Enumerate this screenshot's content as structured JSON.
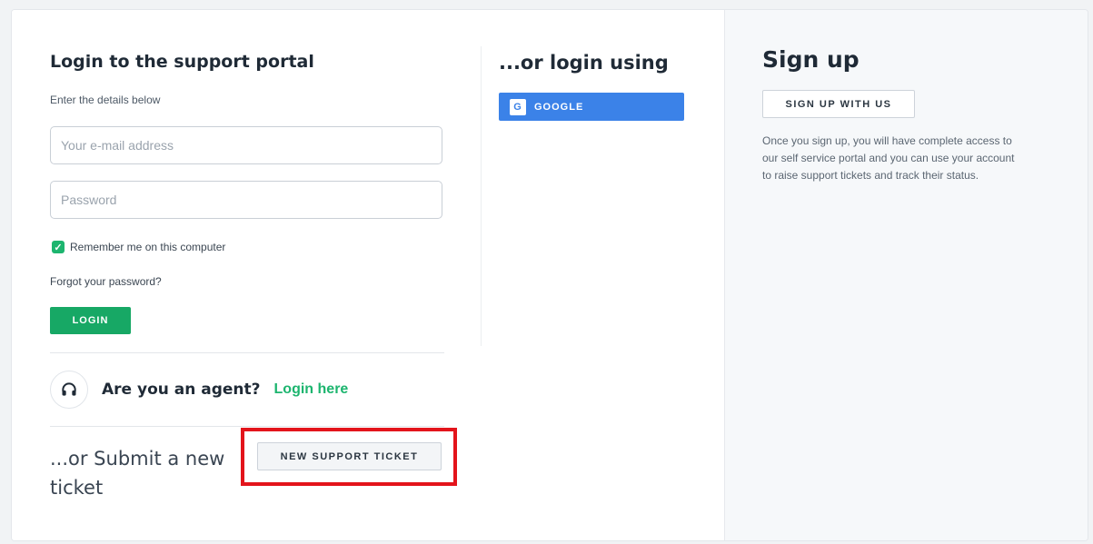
{
  "login": {
    "title": "Login to the support portal",
    "hint": "Enter the details below",
    "email_placeholder": "Your e-mail address",
    "password_placeholder": "Password",
    "remember_label": "Remember me on this computer",
    "remember_checked": true,
    "forgot_label": "Forgot your password?",
    "login_button": "LOGIN"
  },
  "social": {
    "title": "...or login using",
    "google_button": "GOOGLE",
    "google_icon": "G"
  },
  "agent": {
    "question": "Are you an agent?",
    "link": "Login here"
  },
  "ticket": {
    "text": "...or Submit a new ticket",
    "button": "NEW SUPPORT TICKET"
  },
  "signup": {
    "title": "Sign up",
    "button": "SIGN UP WITH US",
    "description": "Once you sign up, you will have complete access to our self service portal and you can use your account to raise support tickets and track their status."
  },
  "colors": {
    "accent_green": "#17a865",
    "google_blue": "#3b82e8",
    "highlight_red": "#e3141b"
  }
}
